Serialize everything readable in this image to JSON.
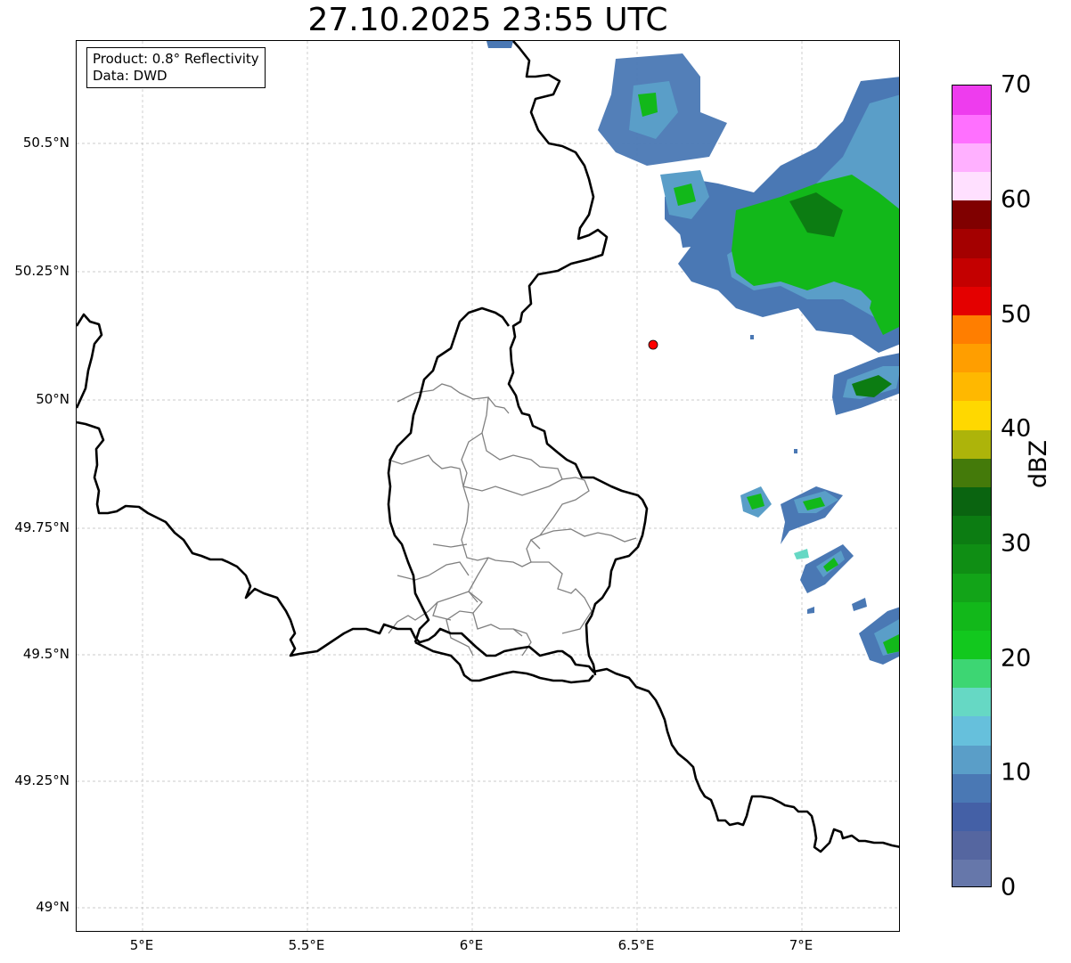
{
  "title": "27.10.2025 23:55 UTC",
  "info": {
    "product": "Product: 0.8° Reflectivity",
    "data": "Data: DWD"
  },
  "axes": {
    "lon_ticks": [
      "5°E",
      "5.5°E",
      "6°E",
      "6.5°E",
      "7°E"
    ],
    "lat_ticks": [
      "50.5°N",
      "50.25°N",
      "50°N",
      "49.75°N",
      "49.5°N",
      "49.25°N",
      "49°N"
    ],
    "lon_range": [
      4.8,
      7.3
    ],
    "lat_range": [
      48.95,
      50.7
    ],
    "grid": true
  },
  "marker": {
    "lon": 6.55,
    "lat": 50.11,
    "color": "#ff0000"
  },
  "colorbar": {
    "label": "dBZ",
    "range": [
      0,
      70
    ],
    "tick_labels": [
      "0",
      "10",
      "20",
      "30",
      "40",
      "50",
      "60",
      "70"
    ],
    "colors": [
      "#6677aa",
      "#5566a0",
      "#4460a6",
      "#4a78b4",
      "#5a9ec8",
      "#66c0dc",
      "#66d8c4",
      "#3dd673",
      "#12c81e",
      "#12b81a",
      "#12a418",
      "#0f8e14",
      "#0c7c12",
      "#0a6410",
      "#447a0a",
      "#adb40a",
      "#ffd800",
      "#ffb800",
      "#ff9e00",
      "#ff7e00",
      "#e40000",
      "#c40000",
      "#a40000",
      "#800000",
      "#ffe0ff",
      "#ffb0ff",
      "#ff70ff",
      "#ee3cee"
    ]
  }
}
